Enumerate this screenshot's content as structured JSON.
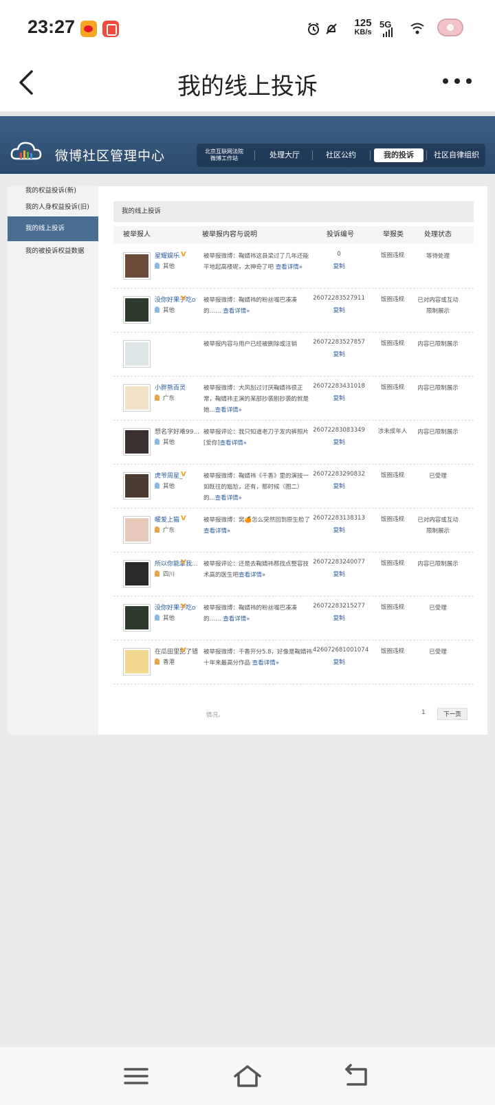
{
  "status_bar": {
    "time": "23:27",
    "speed_value": "125",
    "speed_unit": "KB/s",
    "network": "5G"
  },
  "header": {
    "title": "我的线上投诉"
  },
  "banner": {
    "title": "微博社区管理中心",
    "court_label_line1": "北京互联网法院",
    "court_label_line2": "微博工作站",
    "nav": [
      "处理大厅",
      "社区公约",
      "我的投诉",
      "社区自律组织"
    ],
    "active_nav": "我的投诉"
  },
  "sidebar": {
    "items": [
      "我的权益投诉(新)",
      "我的人身权益投诉(旧)",
      "我的线上投诉",
      "我的被投诉权益数据"
    ],
    "active": "我的线上投诉"
  },
  "content": {
    "title": "我的线上投诉",
    "columns": [
      "被举报人",
      "被举报内容与说明",
      "投诉编号",
      "举报类",
      "处理状态"
    ],
    "copy_label": "复制",
    "detail_label": "查看详情»",
    "rows": [
      {
        "user": "星耀娱乐",
        "verified": true,
        "region": "其他",
        "desc": "被举报微博：鞠婧祎这县梁过了几年还能平地起高楼呢，太神奇了吧 ",
        "id": "0",
        "type": "饭圈违规",
        "status": "等待处理",
        "avatar": "#6b4a3a"
      },
      {
        "user": "没你好果子吃o",
        "verified": true,
        "region": "其他",
        "desc": "被举报微博：鞠婧祎的粉丝嘴巴凑凑的…… ",
        "id": "26072283527911",
        "type": "饭圈违规",
        "status": "已对内容或互动限制展示",
        "avatar": "#2f3a2f"
      },
      {
        "user": "",
        "verified": false,
        "region": "",
        "desc": "被举报内容与用户已经被删除或注销",
        "id": "26072283527857",
        "type": "饭圈违规",
        "status": "内容已限制展示",
        "avatar": "#dfe6e8"
      },
      {
        "user": "小胖熊百灵",
        "verified": false,
        "region": "广东",
        "desc": "被举报微博：大风刮过讨厌鞠婧祎很正常，鞠婧祎主演的某部抄袭剧抄袭的就是她...",
        "id": "26072283431018",
        "type": "饭圈违规",
        "status": "内容已限制展示",
        "avatar": "#f3e2c8"
      },
      {
        "user": "想名字好难99...",
        "verified": false,
        "region": "其他",
        "desc": "被举报评论：我只知道老刀子发内裤照片[爱你]",
        "id": "26072283083349",
        "type": "涉未成年人",
        "status": "内容已限制展示",
        "avatar": "#3a3030"
      },
      {
        "user": "虎爷周星_",
        "verified": true,
        "region": "其他",
        "desc": "被举报微博：鞠婧祎《千香》里的演技一如既往的尴尬，还有，那时候（图二）的...",
        "id": "26072283290832",
        "type": "饭圈违规",
        "status": "已受理",
        "avatar": "#4a3a30"
      },
      {
        "user": "暖爱上猫",
        "verified": true,
        "region": "广东",
        "desc": "被举报微博：窝🍊怎么突然回到原生脸了 ",
        "id": "26072283138313",
        "type": "饭圈违规",
        "status": "已对内容或互动限制展示",
        "avatar": "#e8c8b8"
      },
      {
        "user": "所以你能拿我...",
        "verified": true,
        "region": "四川",
        "desc": "被举报评论：还是去鞠婧祎那找点整容技术高的医生吧",
        "id": "26072283240077",
        "type": "饭圈违规",
        "status": "内容已限制展示",
        "avatar": "#2a2a2a"
      },
      {
        "user": "没你好果子吃o",
        "verified": true,
        "region": "其他",
        "desc": "被举报微博：鞠婧祎的粉丝嘴巴凑凑的…… ",
        "id": "26072283215277",
        "type": "饭圈违规",
        "status": "已受理",
        "avatar": "#2f3a2f"
      },
      {
        "user": "在瓜田里犯了错",
        "verified": true,
        "region": "香港",
        "desc": "被举报微博：千香开分5.8，好像是鞠婧祎十年来最高分作品 ",
        "id": "426072681001074",
        "type": "饭圈违规",
        "status": "已受理",
        "avatar": "#f3d890"
      }
    ],
    "footer_note": "情况。",
    "page_number": "1",
    "next_label": "下一页"
  }
}
